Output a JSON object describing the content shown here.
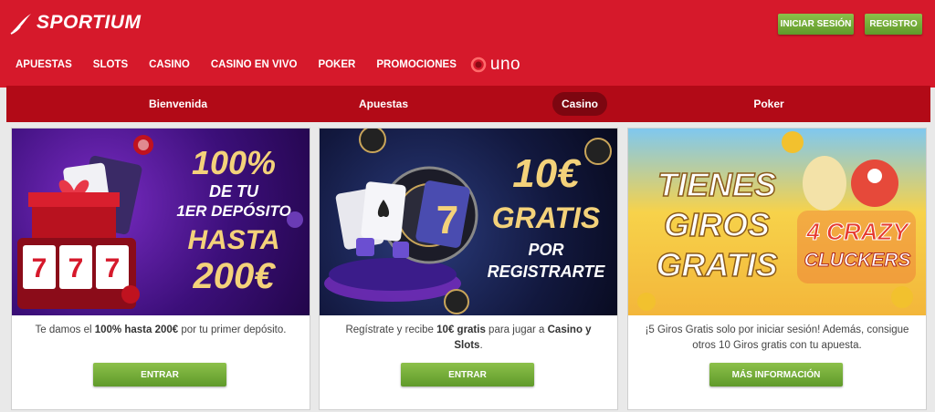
{
  "brand": {
    "name": "SPORTIUM"
  },
  "header": {
    "login_label": "INICIAR SESIÓN",
    "register_label": "REGISTRO",
    "nav": [
      "APUESTAS",
      "SLOTS",
      "CASINO",
      "CASINO EN VIVO",
      "POKER",
      "PROMOCIONES"
    ],
    "partner": "uno"
  },
  "tabs": [
    {
      "label": "Bienvenida",
      "active": false
    },
    {
      "label": "Apuestas",
      "active": false
    },
    {
      "label": "Casino",
      "active": true
    },
    {
      "label": "Poker",
      "active": false
    }
  ],
  "cards": [
    {
      "banner_lines": [
        "100%",
        "DE TU",
        "1ER DEPÓSITO",
        "HASTA",
        "200€"
      ],
      "desc_pre": "Te damos el ",
      "desc_bold": "100% hasta 200€",
      "desc_post": " por tu primer depósito.",
      "cta": "ENTRAR"
    },
    {
      "banner_lines": [
        "10€",
        "GRATIS",
        "POR",
        "REGISTRARTE"
      ],
      "desc_pre": "Regístrate y recibe ",
      "desc_bold": "10€ gratis",
      "desc_mid": " para jugar a ",
      "desc_bold2": "Casino y Slots",
      "desc_post": ".",
      "cta": "ENTRAR"
    },
    {
      "banner_lines": [
        "TIENES",
        "GIROS",
        "GRATIS",
        "4 CRAZY",
        "CLUCKERS"
      ],
      "desc_pre": "¡5 Giros Gratis solo por iniciar sesión! Además, consigue otros 10 Giros gratis con tu apuesta.",
      "cta": "MÁS INFORMACIÓN"
    }
  ],
  "colors": {
    "brand_red": "#d6192b",
    "tab_bar": "#b20a17",
    "active_tab": "#7d0610",
    "cta_green": "#6fa832"
  }
}
